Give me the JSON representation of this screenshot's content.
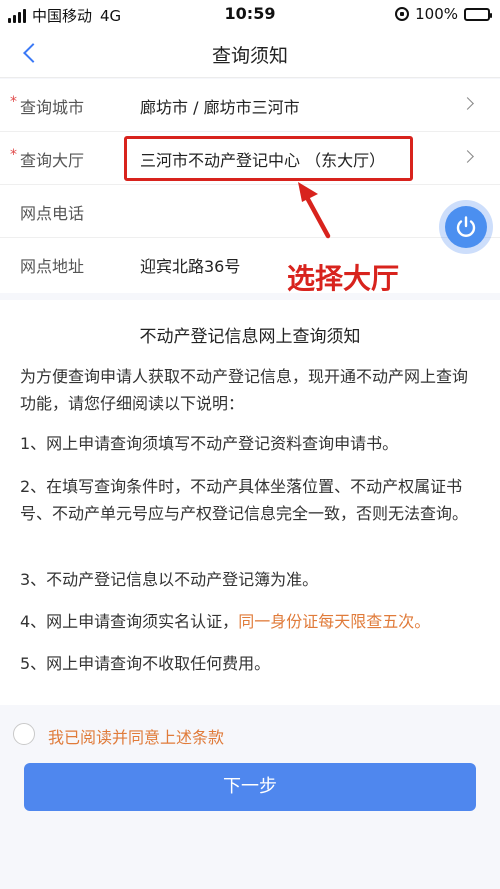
{
  "status_bar": {
    "carrier": "中国移动",
    "network": "4G",
    "time": "10:59",
    "battery": "100%",
    "battery_level": 1.0
  },
  "nav": {
    "title": "查询须知"
  },
  "form": {
    "rows": [
      {
        "required": "*",
        "label": "查询城市",
        "value": "廊坊市 / 廊坊市三河市"
      },
      {
        "required": "*",
        "label": "查询大厅",
        "value": "三河市不动产登记中心 （东大厅）"
      },
      {
        "label": "网点电话",
        "value": ""
      },
      {
        "label": "网点地址",
        "value": "迎宾北路36号"
      }
    ]
  },
  "annotation": {
    "text": "选择大厅",
    "color": "#d8231d"
  },
  "notice": {
    "title": "不动产登记信息网上查询须知",
    "intro": "为方便查询申请人获取不动产登记信息，现开通不动产网上查询功能，请您仔细阅读以下说明：",
    "items": [
      "1、网上申请查询须填写不动产登记资料查询申请书。",
      "2、在填写查询条件时，不动产具体坐落位置、不动产权属证书号、不动产单元号应与产权登记信息完全一致，否则无法查询。",
      "3、不动产登记信息以不动产登记簿为准。",
      "4、网上申请查询须实名认证，",
      "5、网上申请查询不收取任何费用。"
    ],
    "item4_highlight": "同一身份证每天限查五次。"
  },
  "agree": {
    "label": "我已阅读并同意上述条款"
  },
  "next_button": {
    "label": "下一步"
  },
  "colors": {
    "accent": "#4f87ee",
    "highlight": "#e07b3a",
    "annotation": "#d8231d"
  },
  "icons": [
    "back-chevron-icon",
    "chevron-right-icon",
    "power-icon",
    "signal-icon",
    "rotation-lock-icon",
    "battery-icon"
  ]
}
